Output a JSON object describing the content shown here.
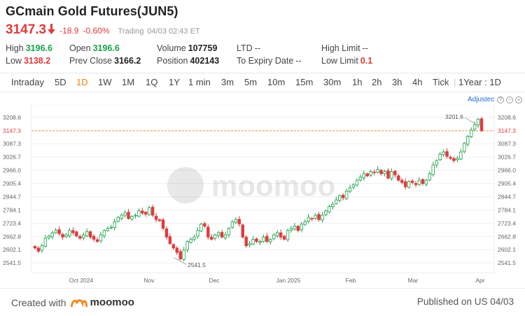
{
  "header": {
    "title": "GCmain Gold Futures(JUN5)",
    "last_price": "3147.3",
    "change": "-18.9",
    "change_pct": "-0.60%",
    "status": "Trading",
    "timestamp": "04/03 02:43 ET"
  },
  "stats": {
    "high_label": "High",
    "high_value": "3196.6",
    "low_label": "Low",
    "low_value": "3138.2",
    "open_label": "Open",
    "open_value": "3196.6",
    "prev_close_label": "Prev Close",
    "prev_close_value": "3166.2",
    "volume_label": "Volume",
    "volume_value": "107759",
    "position_label": "Position",
    "position_value": "402143",
    "ltd_label": "LTD",
    "ltd_value": "--",
    "expiry_label": "To Expiry Date",
    "expiry_value": "--",
    "high_limit_label": "High Limit",
    "high_limit_value": "--",
    "low_limit_label": "Low Limit",
    "low_limit_value": "0.1"
  },
  "intervals": [
    "Intraday",
    "5D",
    "1D",
    "1W",
    "1M",
    "1Q",
    "1Y",
    "1 min",
    "3m",
    "5m",
    "10m",
    "15m",
    "30m",
    "1h",
    "2h",
    "3h",
    "4h",
    "Tick",
    "1Year : 1D"
  ],
  "active_interval": "1D",
  "chart_controls": {
    "adjusted_label": "Adjustec"
  },
  "watermark": "moomoo",
  "footer": {
    "created_with": "Created with",
    "brand": "moomoo",
    "published": "Published on US 04/03"
  },
  "colors": {
    "up": "#1aa14a",
    "down": "#e03a3e",
    "active": "#e8830c",
    "accent": "#f08a24"
  },
  "chart_data": {
    "type": "candlestick",
    "x_ticks": [
      "Oct 2024",
      "Nov",
      "Dec",
      "Jan 2025",
      "Feb",
      "Mar",
      "Apr"
    ],
    "y_ticks": [
      3208.6,
      3147.3,
      3087.3,
      3026.7,
      2966.0,
      2905.4,
      2844.7,
      2784.1,
      2723.4,
      2662.8,
      2602.1,
      2541.5
    ],
    "ylim": [
      2510,
      3240
    ],
    "current_price": 3147.3,
    "annotations": [
      {
        "label": "3201.6",
        "value": 3201.6
      },
      {
        "label": "2541.5",
        "value": 2541.5
      }
    ],
    "closes": [
      2610,
      2595,
      2620,
      2655,
      2665,
      2680,
      2690,
      2675,
      2660,
      2670,
      2690,
      2680,
      2665,
      2655,
      2670,
      2685,
      2660,
      2650,
      2640,
      2670,
      2690,
      2700,
      2705,
      2730,
      2750,
      2760,
      2770,
      2745,
      2755,
      2760,
      2780,
      2770,
      2765,
      2795,
      2760,
      2740,
      2735,
      2700,
      2660,
      2630,
      2610,
      2590,
      2560,
      2600,
      2640,
      2650,
      2660,
      2690,
      2720,
      2710,
      2660,
      2650,
      2670,
      2680,
      2660,
      2670,
      2700,
      2730,
      2740,
      2720,
      2660,
      2620,
      2630,
      2650,
      2640,
      2640,
      2660,
      2640,
      2650,
      2670,
      2680,
      2660,
      2650,
      2690,
      2700,
      2710,
      2690,
      2720,
      2730,
      2750,
      2745,
      2760,
      2740,
      2760,
      2780,
      2800,
      2810,
      2830,
      2850,
      2840,
      2870,
      2885,
      2900,
      2920,
      2935,
      2950,
      2940,
      2960,
      2955,
      2970,
      2950,
      2960,
      2930,
      2960,
      2945,
      2920,
      2910,
      2890,
      2915,
      2910,
      2900,
      2920,
      2905,
      2920,
      2950,
      2990,
      3010,
      3040,
      3050,
      3030,
      3020,
      3010,
      3020,
      3050,
      3090,
      3120,
      3150,
      3175,
      3200,
      3147.3
    ]
  }
}
